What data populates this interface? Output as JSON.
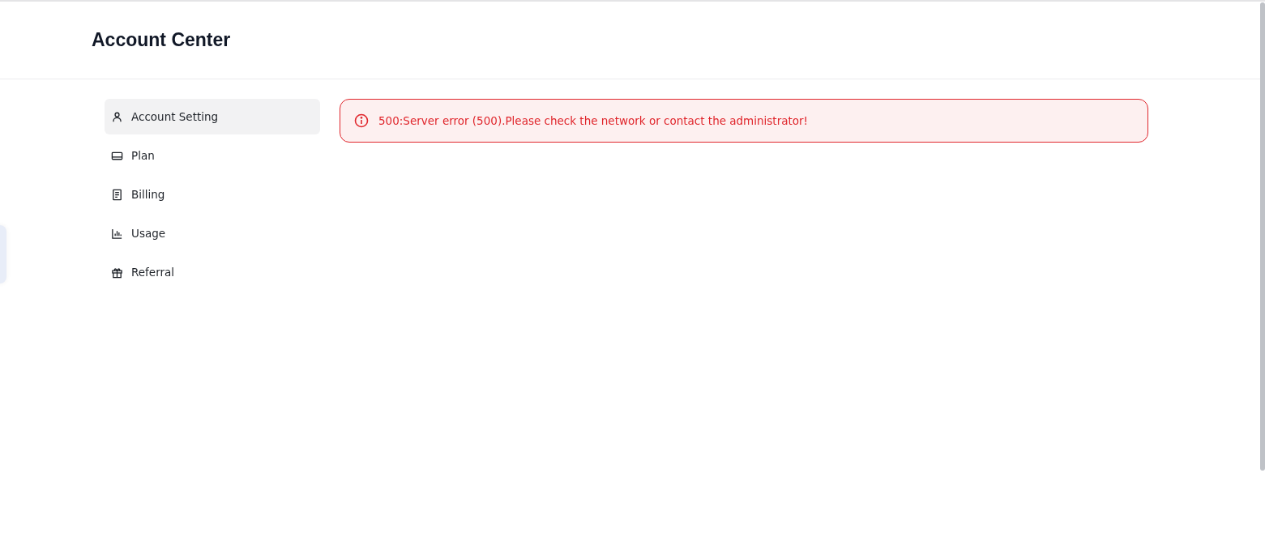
{
  "page": {
    "title": "Account Center"
  },
  "sidebar": {
    "items": [
      {
        "label": "Account Setting",
        "kind": "person",
        "selected": true
      },
      {
        "label": "Plan",
        "kind": "card",
        "selected": false
      },
      {
        "label": "Billing",
        "kind": "receipt",
        "selected": false
      },
      {
        "label": "Usage",
        "kind": "chart",
        "selected": false
      },
      {
        "label": "Referral",
        "kind": "gift",
        "selected": false
      }
    ]
  },
  "alert": {
    "kind": "error",
    "message": "500:Server error (500).Please check the network or contact the administrator!"
  }
}
